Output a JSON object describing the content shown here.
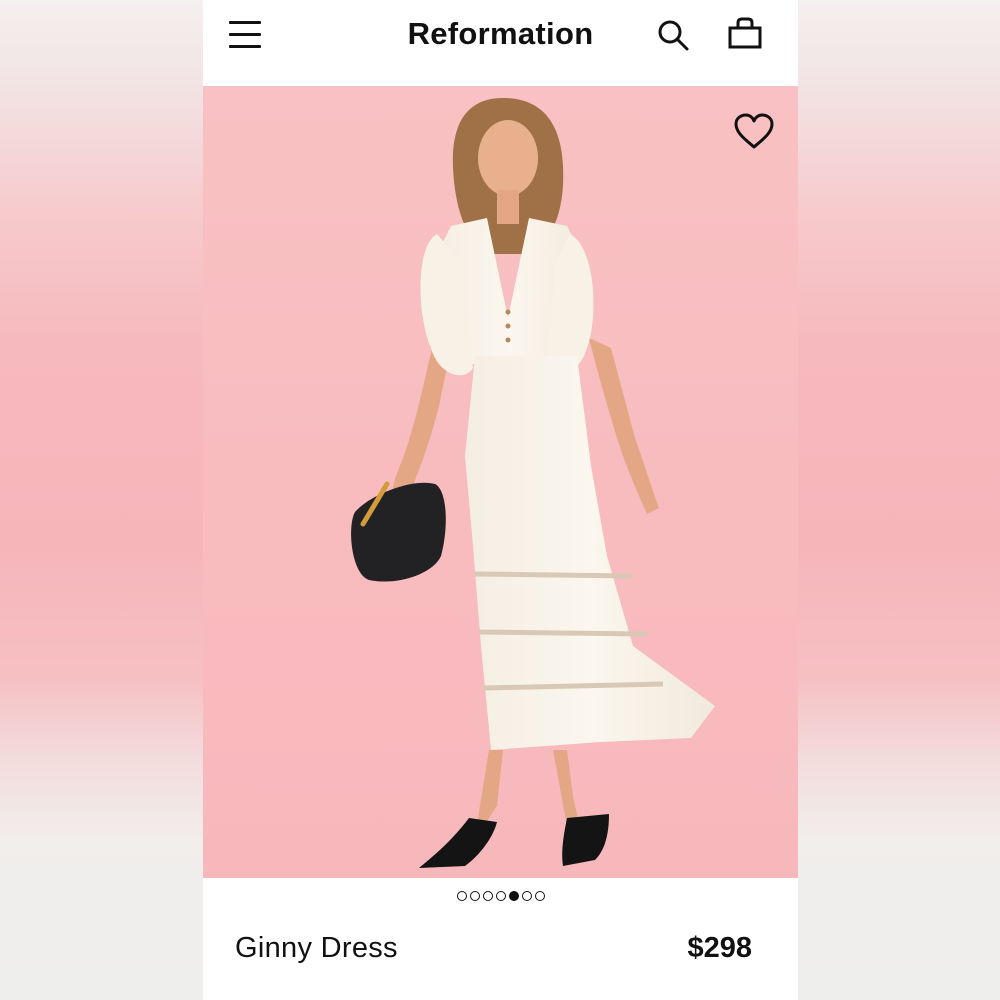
{
  "header": {
    "brand": "Reformation",
    "icons": {
      "menu": "hamburger-menu-icon",
      "search": "search-icon",
      "bag": "shopping-bag-icon"
    }
  },
  "product_image": {
    "wishlist_icon": "heart-outline-icon",
    "background_color": "#f8bcbf"
  },
  "carousel": {
    "total_images": 7,
    "active_index": 4
  },
  "product": {
    "name": "Ginny Dress",
    "price": "$298"
  }
}
